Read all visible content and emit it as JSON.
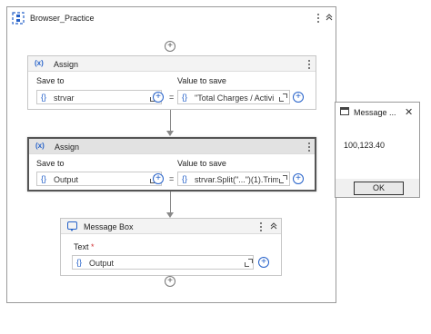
{
  "sequence": {
    "title": "Browser_Practice",
    "collapse_glyph": "⌃"
  },
  "activities": [
    {
      "type": "Assign",
      "icon": "(x)",
      "save_to_label": "Save to",
      "value_label": "Value to save",
      "save_to": "strvar",
      "value": "\"Total Charges / Activi",
      "equals": "="
    },
    {
      "type": "Assign",
      "icon": "(x)",
      "save_to_label": "Save to",
      "value_label": "Value to save",
      "save_to": "Output",
      "value": "strvar.Split(\"...\")(1).Trim",
      "equals": "="
    }
  ],
  "message_box": {
    "title": "Message Box",
    "text_label": "Text",
    "required_marker": "*",
    "text_value": "Output"
  },
  "dialog": {
    "title": "Message ...",
    "message": "100,123.40",
    "ok_label": "OK",
    "close_glyph": "✕"
  },
  "glyphs": {
    "brace": "{}",
    "plus": "+"
  },
  "colors": {
    "accent": "#2561c9",
    "required": "#d13438"
  }
}
